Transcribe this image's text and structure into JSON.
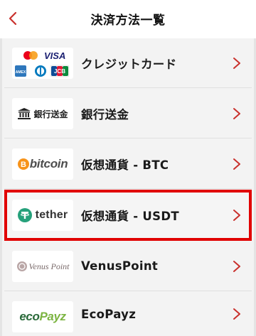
{
  "header": {
    "title": "決済方法一覧"
  },
  "colors": {
    "accent_red": "#c9302c",
    "selected_border": "#e10000",
    "row_bg": "#f3f3f3"
  },
  "methods": [
    {
      "label": "クレジットカード",
      "logo": {
        "visa_text": "VISA",
        "jcb_text": "JCB",
        "amex_text": "AMEX"
      },
      "selected": false
    },
    {
      "label": "銀行送金",
      "logo": {
        "text": "銀行送金",
        "icon": "bank-icon"
      },
      "selected": false
    },
    {
      "label": "仮想通貨 - BTC",
      "logo": {
        "text": "bitcoin",
        "icon": "bitcoin-icon"
      },
      "selected": false
    },
    {
      "label": "仮想通貨 - USDT",
      "logo": {
        "text": "tether",
        "icon": "tether-icon"
      },
      "selected": true
    },
    {
      "label": "VenusPoint",
      "logo": {
        "text": "Venus Point",
        "icon": "venus-icon"
      },
      "selected": false
    },
    {
      "label": "EcoPayz",
      "logo": {
        "text_part1": "eco",
        "text_part2": "Payz"
      },
      "selected": false
    }
  ]
}
